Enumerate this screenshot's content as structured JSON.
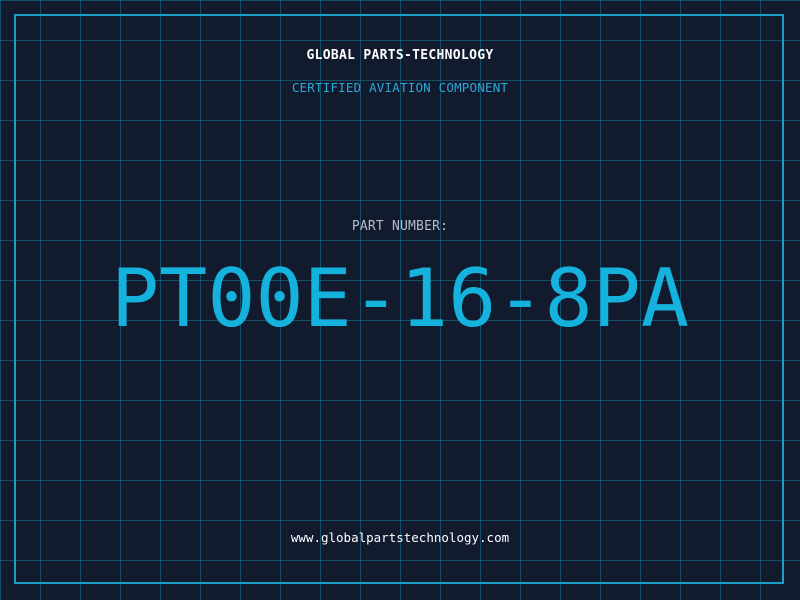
{
  "header": {
    "company": "GLOBAL PARTS-TECHNOLOGY",
    "subtitle": "CERTIFIED AVIATION COMPONENT"
  },
  "part": {
    "label": "PART NUMBER:",
    "number": "PT00E-16-8PA"
  },
  "footer": {
    "url": "www.globalpartstechnology.com"
  },
  "colors": {
    "background": "#121a2e",
    "grid": "#1878a0",
    "accent": "#14b2dc",
    "frame": "#1a9fc9",
    "text_primary": "#ffffff",
    "text_muted": "#b6bccb"
  }
}
